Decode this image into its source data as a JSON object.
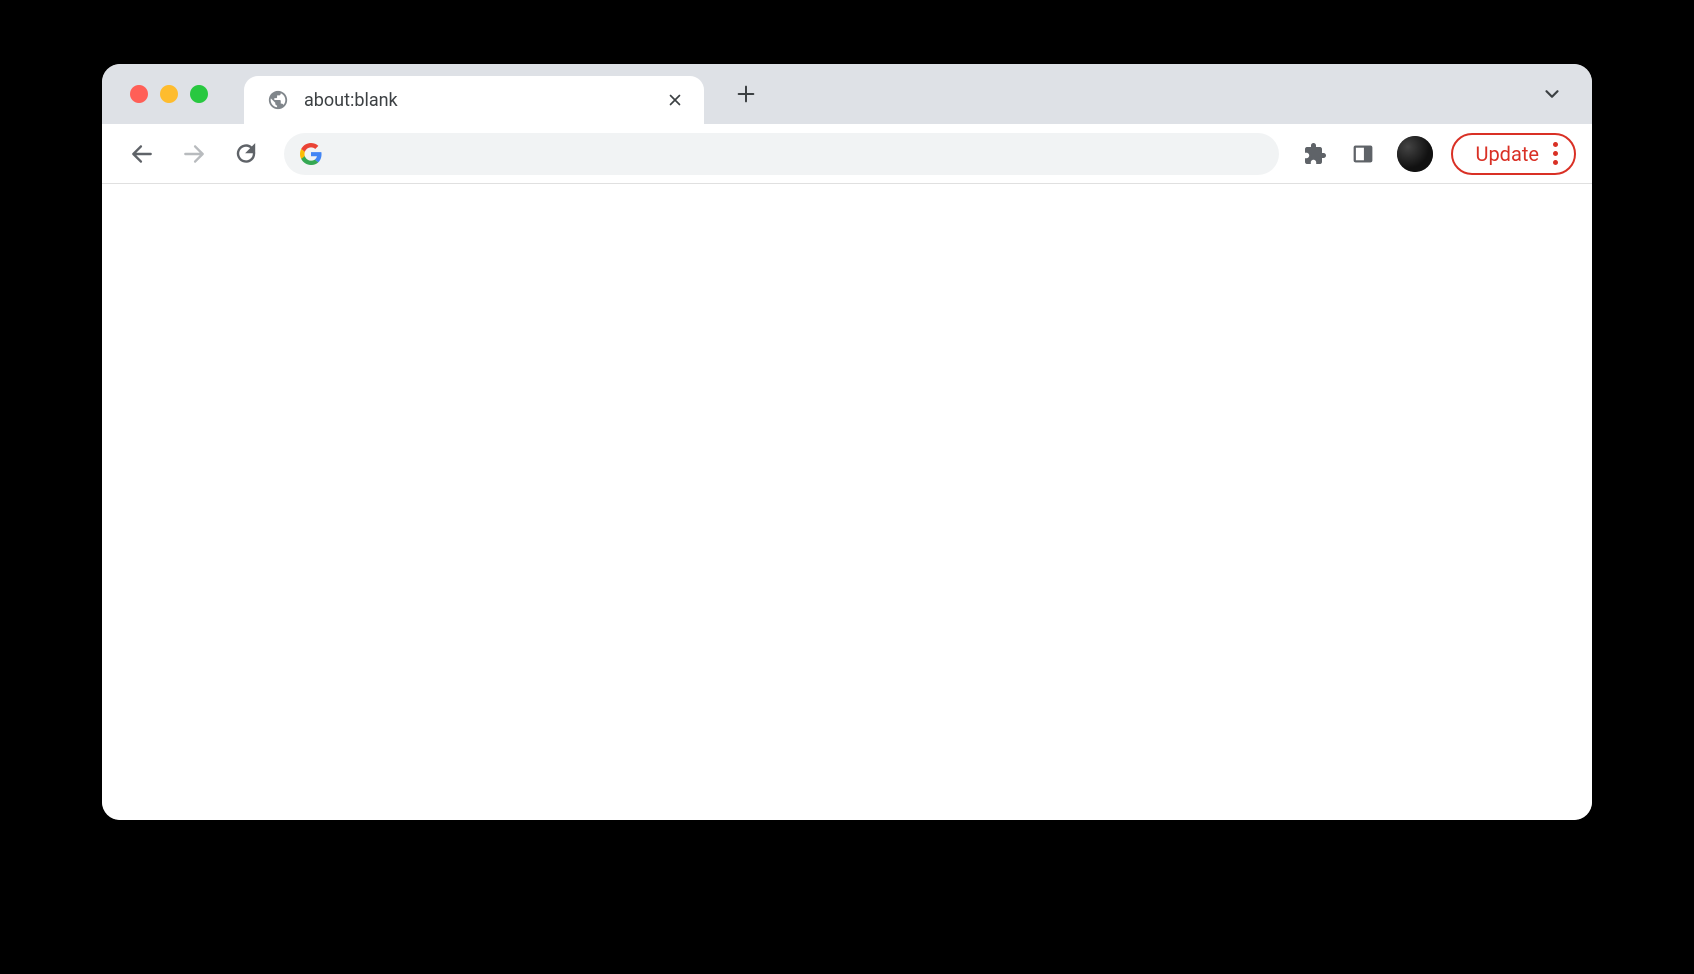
{
  "tabs": [
    {
      "title": "about:blank"
    }
  ],
  "address_bar": {
    "value": ""
  },
  "toolbar": {
    "update_label": "Update"
  },
  "colors": {
    "tab_bar_bg": "#dee1e6",
    "accent_red": "#d93025"
  }
}
